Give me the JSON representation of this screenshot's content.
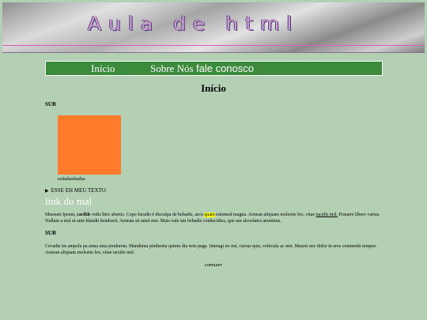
{
  "header": {
    "title": "Aula de html"
  },
  "menu": {
    "items": [
      "Início",
      "Sobre Nós",
      "fale conosco"
    ]
  },
  "page": {
    "title": "Início"
  },
  "section1": {
    "sub": "SUB",
    "image_color": "#ff7a2a",
    "caption": "esdadasdsadsa"
  },
  "details": {
    "summary": "ESSE EH MEU TEXTO"
  },
  "link": {
    "text": "link do mal"
  },
  "paragraph1": {
    "a": "Mussum Ipsum, ",
    "bold": "cacilds",
    "b": " vidis litro abertis. Copo furadis é disculpa de bebadis, arcu ",
    "highlight": "quam",
    "c": " euismod magna. Aenean aliquam molestie leo, vitae ",
    "underline": "iaculis nisl.",
    "d": " Posuere libero varius. Nullam a nisl ut ante blandit hendrerit. Aenean sit amet nisi. Mais vale um bebadis conhecidiss, que um alcoolatra anonimis."
  },
  "section2": {
    "sub": "SUB",
    "paragraph": "Cevadis im ampola pa arma uma pindureta. Manduma pindureta quium dia nois paga. Interagi no mé, cursus quis, vehicula ac nisi. Mauris nec dolor in eros commodo tempor. Aenean aliquam molestie leo, vitae iaculis nisl."
  },
  "footer": {
    "text": "COPYLEFT"
  }
}
